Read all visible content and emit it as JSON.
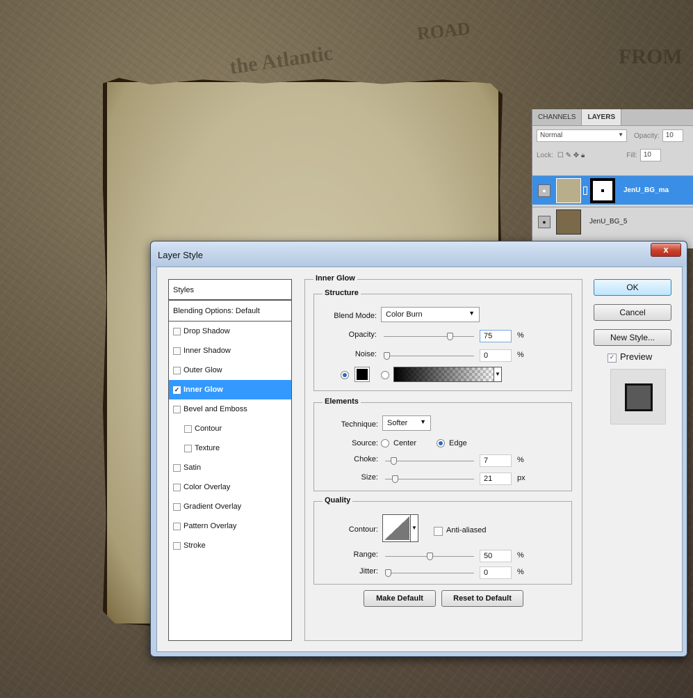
{
  "background": {
    "text1": "the Atlantic",
    "text2": "ROAD",
    "text3": "FROM"
  },
  "layers_panel": {
    "tabs": [
      "CHANNELS",
      "LAYERS"
    ],
    "blend_mode": "Normal",
    "opacity_label": "Opacity:",
    "opacity_value": "10",
    "lock_label": "Lock:",
    "fill_label": "Fill:",
    "fill_value": "10",
    "layers": [
      {
        "name": "JenU_BG_ma",
        "selected": true
      },
      {
        "name": "JenU_BG_5",
        "selected": false
      }
    ]
  },
  "dialog": {
    "title": "Layer Style",
    "close": "x",
    "styles_header": "Styles",
    "blending_options": "Blending Options: Default",
    "style_items": [
      {
        "label": "Drop Shadow",
        "checked": false
      },
      {
        "label": "Inner Shadow",
        "checked": false
      },
      {
        "label": "Outer Glow",
        "checked": false
      },
      {
        "label": "Inner Glow",
        "checked": true,
        "selected": true
      },
      {
        "label": "Bevel and Emboss",
        "checked": false
      },
      {
        "label": "Contour",
        "checked": false,
        "indent": true
      },
      {
        "label": "Texture",
        "checked": false,
        "indent": true
      },
      {
        "label": "Satin",
        "checked": false
      },
      {
        "label": "Color Overlay",
        "checked": false
      },
      {
        "label": "Gradient Overlay",
        "checked": false
      },
      {
        "label": "Pattern Overlay",
        "checked": false
      },
      {
        "label": "Stroke",
        "checked": false
      }
    ],
    "inner_glow": {
      "title": "Inner Glow",
      "structure": {
        "title": "Structure",
        "blend_mode_label": "Blend Mode:",
        "blend_mode": "Color Burn",
        "opacity_label": "Opacity:",
        "opacity": "75",
        "opacity_fraction": 0.75,
        "opacity_unit": "%",
        "noise_label": "Noise:",
        "noise": "0",
        "noise_fraction": 0,
        "noise_unit": "%",
        "color": "#000000"
      },
      "elements": {
        "title": "Elements",
        "technique_label": "Technique:",
        "technique": "Softer",
        "source_label": "Source:",
        "source_center": "Center",
        "source_edge": "Edge",
        "source": "Edge",
        "choke_label": "Choke:",
        "choke": "7",
        "choke_fraction": 0.07,
        "choke_unit": "%",
        "size_label": "Size:",
        "size": "21",
        "size_fraction": 0.08,
        "size_unit": "px"
      },
      "quality": {
        "title": "Quality",
        "contour_label": "Contour:",
        "anti_aliased": "Anti-aliased",
        "range_label": "Range:",
        "range": "50",
        "range_fraction": 0.5,
        "range_unit": "%",
        "jitter_label": "Jitter:",
        "jitter": "0",
        "jitter_fraction": 0,
        "jitter_unit": "%"
      },
      "make_default": "Make Default",
      "reset_default": "Reset to Default"
    },
    "buttons": {
      "ok": "OK",
      "cancel": "Cancel",
      "new_style": "New Style...",
      "preview": "Preview"
    }
  }
}
